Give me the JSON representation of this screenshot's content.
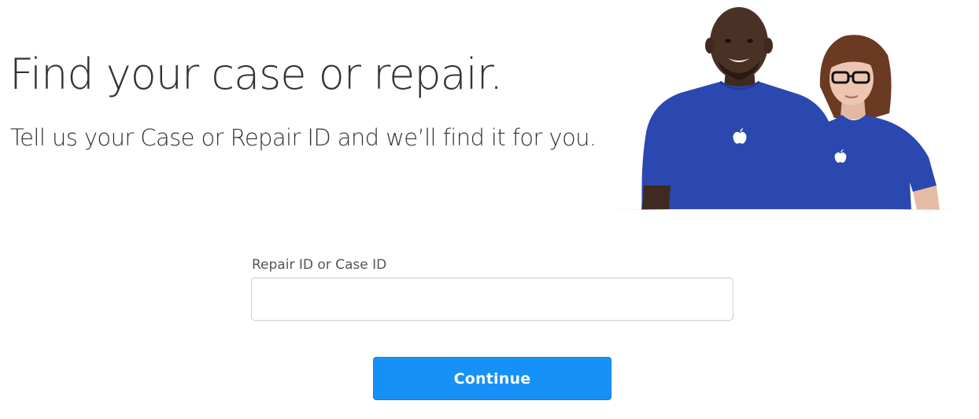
{
  "header": {
    "title": "Find your case or repair.",
    "subtitle": "Tell us your Case or Repair ID and we’ll find it for you."
  },
  "hero": {
    "icon": "apple-logo-icon",
    "shirt_color": "#2b48b0",
    "logo_color": "#ffffff"
  },
  "form": {
    "label": "Repair ID or Case ID",
    "value": "",
    "placeholder": ""
  },
  "actions": {
    "continue_label": "Continue",
    "accent": "#1691f7"
  }
}
